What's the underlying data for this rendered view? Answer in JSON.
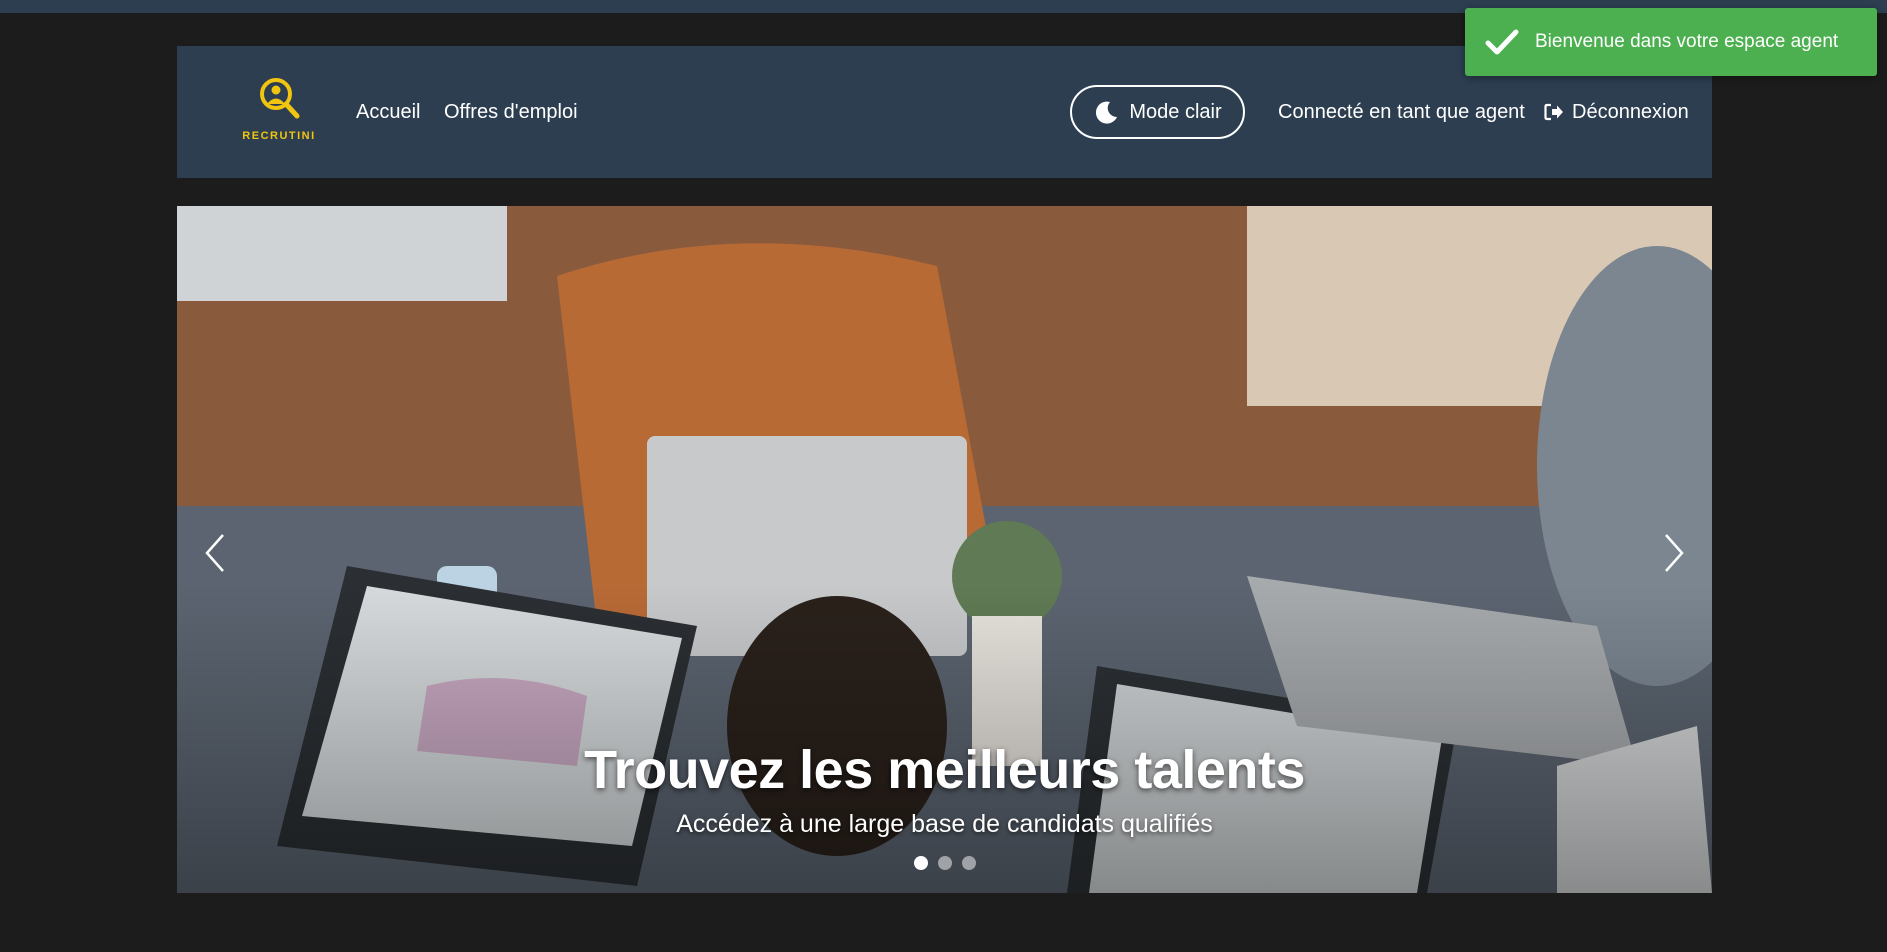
{
  "brand": {
    "name": "RECRUTINI",
    "accent": "#f1c40f"
  },
  "nav": {
    "home_label": "Accueil",
    "jobs_label": "Offres d'emploi",
    "mode_label": "Mode clair",
    "status_label": "Connecté en tant que agent",
    "logout_label": "Déconnexion"
  },
  "carousel": {
    "title": "Trouvez les meilleurs talents",
    "subtitle": "Accédez à une large base de candidats qualifiés",
    "slide_count": 3,
    "active_slide": 1
  },
  "toast": {
    "message": "Bienvenue dans votre espace agent",
    "color": "#4caf50"
  },
  "icons": {
    "logo": "magnifier-person-icon",
    "mode": "moon-icon",
    "logout": "sign-out-icon",
    "toast": "check-icon",
    "prev": "chevron-left-icon",
    "next": "chevron-right-icon"
  },
  "theme": {
    "navbar": "#2c3e50",
    "background": "#1c1c1c"
  }
}
